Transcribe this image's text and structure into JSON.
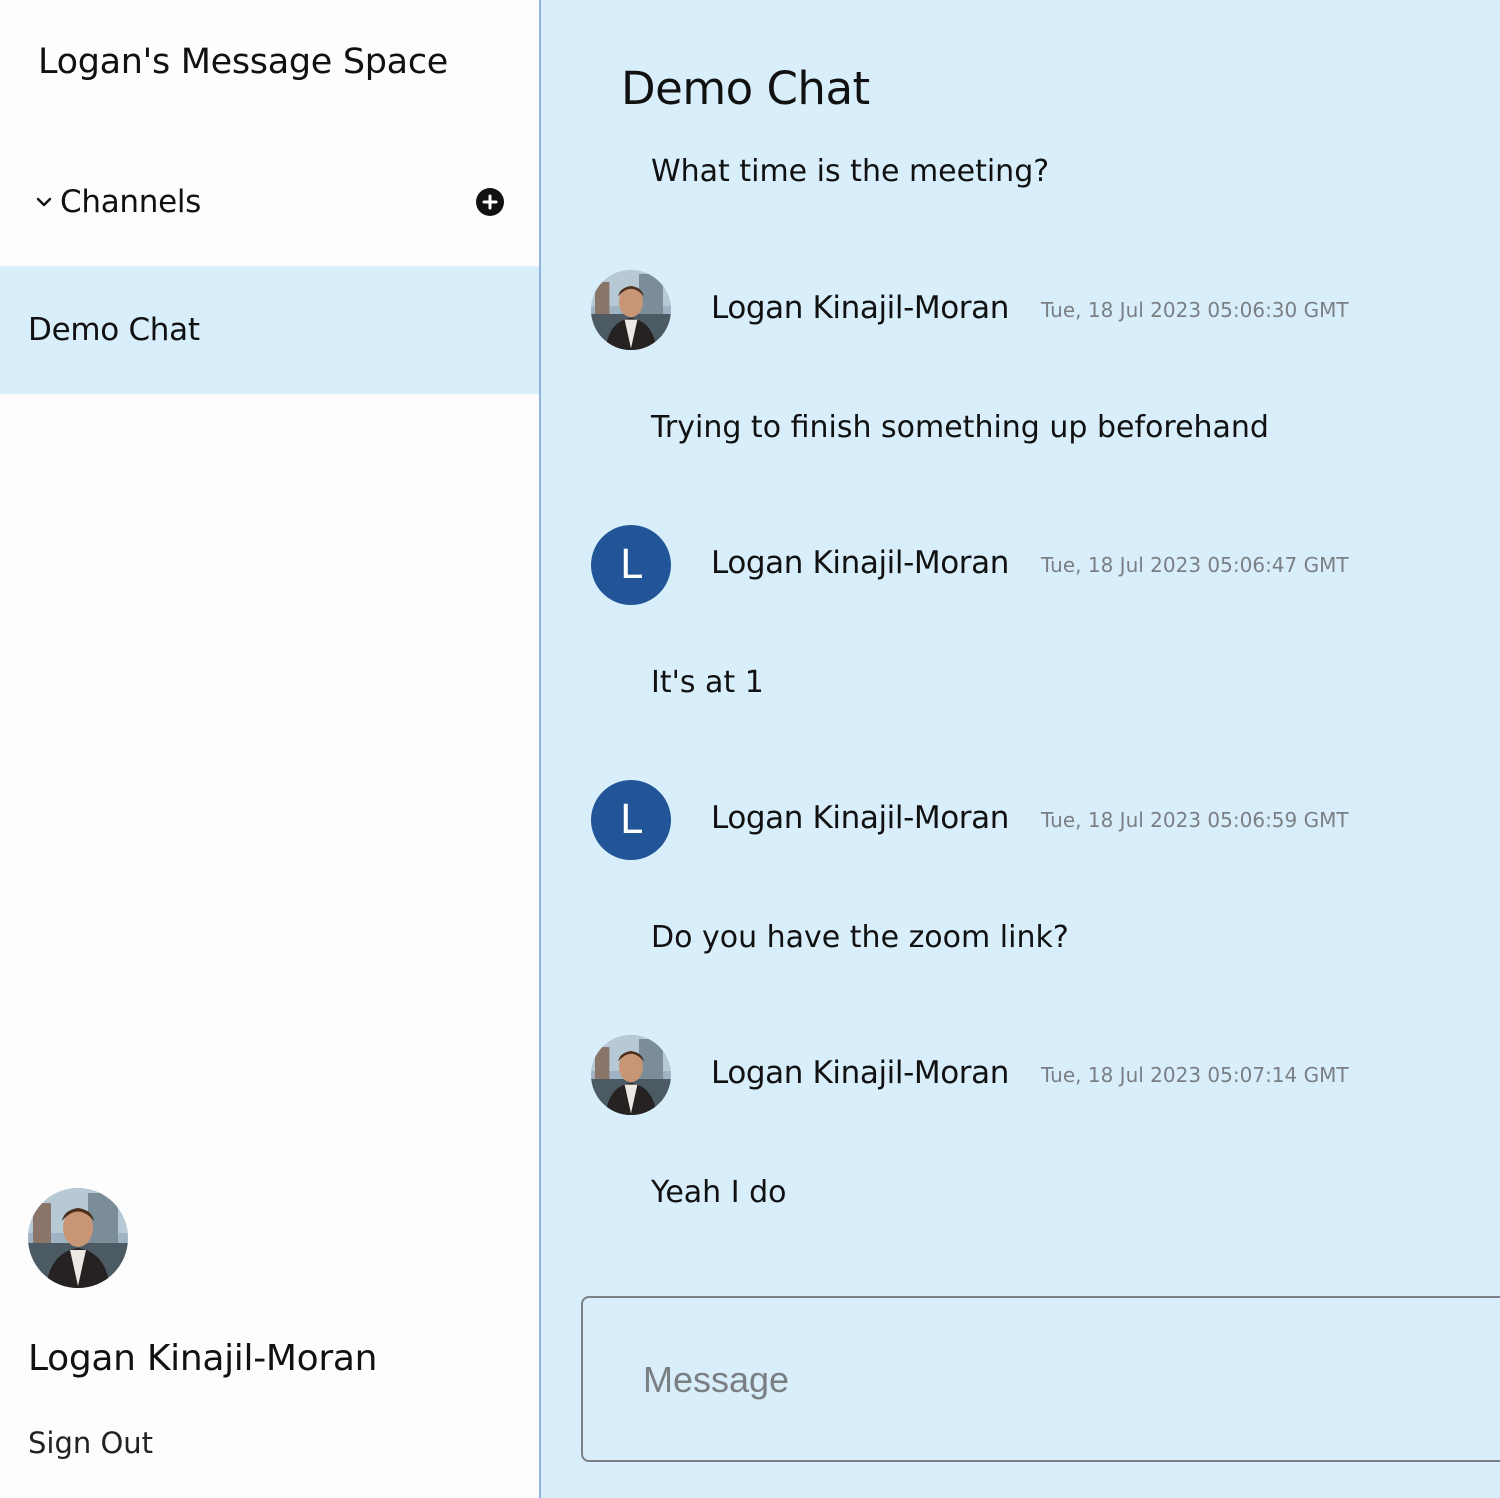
{
  "sidebar": {
    "workspace_title": "Logan's Message Space",
    "channels_label": "Channels",
    "channels": [
      {
        "label": "Demo Chat",
        "selected": true
      }
    ],
    "user": {
      "name": "Logan Kinajil-Moran",
      "sign_out_label": "Sign Out"
    }
  },
  "main": {
    "chat_title": "Demo Chat",
    "partial_message": "What time is the meeting?",
    "messages": [
      {
        "author": "Logan Kinajil-Moran",
        "time": "Tue, 18 Jul 2023 05:06:30 GMT",
        "text": "Trying to finish something up beforehand",
        "avatar": "photo"
      },
      {
        "author": "Logan Kinajil-Moran",
        "time": "Tue, 18 Jul 2023 05:06:47 GMT",
        "text": "It's at 1",
        "avatar": "letter",
        "initial": "L"
      },
      {
        "author": "Logan Kinajil-Moran",
        "time": "Tue, 18 Jul 2023 05:06:59 GMT",
        "text": "Do you have the zoom link?",
        "avatar": "letter",
        "initial": "L"
      },
      {
        "author": "Logan Kinajil-Moran",
        "time": "Tue, 18 Jul 2023 05:07:14 GMT",
        "text": "Yeah I do",
        "avatar": "photo"
      }
    ],
    "composer": {
      "placeholder": "Message"
    }
  },
  "colors": {
    "accent_bg": "#d8eefb",
    "avatar_letter_bg": "#215597",
    "divider": "#8fb3de"
  }
}
